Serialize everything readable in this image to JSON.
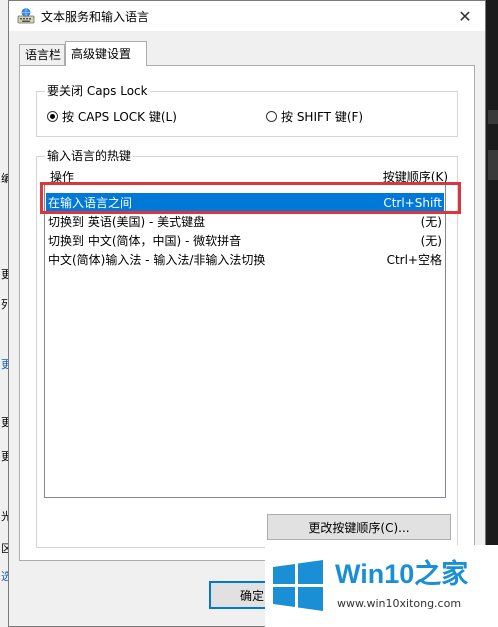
{
  "window": {
    "title": "文本服务和输入语言",
    "close_glyph": "✕"
  },
  "tabs": [
    {
      "label": "语言栏"
    },
    {
      "label": "高级键设置"
    }
  ],
  "caps_lock_group": {
    "title": "要关闭 Caps Lock",
    "option_capslock": "按 CAPS LOCK 键(L)",
    "option_shift": "按 SHIFT 键(F)",
    "selected": "capslock"
  },
  "hotkeys_group": {
    "title": "输入语言的热键",
    "col_action": "操作",
    "col_sequence": "按键顺序(K)",
    "rows": [
      {
        "action": "在输入语言之间",
        "sequence": "Ctrl+Shift"
      },
      {
        "action": "切换到 英语(美国) - 美式键盘",
        "sequence": "(无)"
      },
      {
        "action": "切换到 中文(简体，中国) - 微软拼音",
        "sequence": "(无)"
      },
      {
        "action": "中文(简体)输入法 - 输入法/非输入法切换",
        "sequence": "Ctrl+空格"
      }
    ],
    "selected_index": 0,
    "change_button": "更改按键顺序(C)..."
  },
  "footer": {
    "ok_button": "确定"
  },
  "background_fragments": [
    "编",
    "更",
    "列",
    "更",
    "更",
    "更",
    "光",
    "区",
    "选"
  ],
  "watermark": {
    "brand_win": "Win",
    "brand_ten": "10",
    "brand_zhi": "之家",
    "url": "www.win10xitong.com"
  },
  "colors": {
    "selection": "#0078d7",
    "annotation_box": "#d9363e",
    "watermark_blue": "#1a8fd6"
  }
}
